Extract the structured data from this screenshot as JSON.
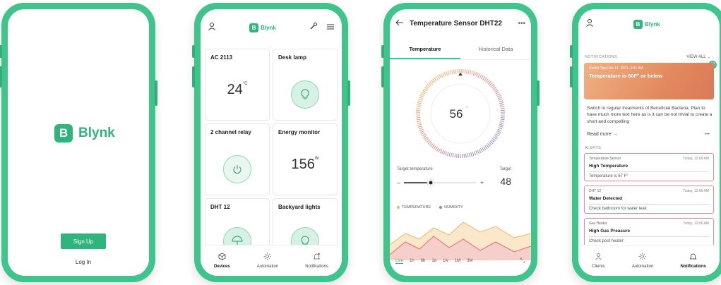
{
  "phone1": {
    "brand": "Blynk",
    "logo_letter": "B",
    "signup": "Sign Up",
    "login": "Log In"
  },
  "phone2": {
    "brand": "Blynk",
    "logo_letter": "B",
    "tiles": [
      {
        "title": "AC 2113",
        "value": "24",
        "unit": "°C"
      },
      {
        "title": "Desk lamp"
      },
      {
        "title": "2 channel relay"
      },
      {
        "title": "Energy monitor",
        "value": "156",
        "unit": "W"
      },
      {
        "title": "DHT 12"
      },
      {
        "title": "Backyard lights"
      }
    ],
    "nav": [
      "Devices",
      "Automation",
      "Notifications"
    ]
  },
  "phone3": {
    "title": "Temperature Sensor DHT22",
    "tabs": [
      "Temperature",
      "Historical Data"
    ],
    "dial_value": "56",
    "dial_unit": "°",
    "target_label": "Target temperature",
    "target_caption": "Target",
    "target_value": "48",
    "legend": [
      "TEMPERATURE",
      "HUMIDITY"
    ],
    "ranges": [
      "Live",
      "1h",
      "6h",
      "1d",
      "1w",
      "1M",
      "3M"
    ],
    "colors": {
      "temperature": "#f2b56b",
      "humidity": "#e96b6b"
    }
  },
  "phone4": {
    "brand": "Blynk",
    "logo_letter": "B",
    "notifications_label": "NOTIFICATIONS",
    "view_all": "VIEW ALL →",
    "badge": "12",
    "hero_tip": "Useful Tips   Feb 14, 2021, 2:01 AM",
    "hero_head": "Temperature is 60F° or below",
    "hero_body": "Switch to regular treatments of Beneficial Bacteria. Plan to have much more text here as is it can be not trivial to create a short and compelling",
    "read_more": "Read more →",
    "alerts_label": "ALERTS",
    "alerts": [
      {
        "source": "Temperature Sensor",
        "time": "Today, 12:06 AM",
        "name": "High Temperature",
        "desc": "Temperature is 67 F°"
      },
      {
        "source": "DHT 12",
        "time": "Today, 12:06 AM",
        "name": "Water Detected",
        "desc": "Check bathroom for water leak"
      },
      {
        "source": "Gas Heater",
        "time": "Today, 12:06 AM",
        "name": "High Gas Preasure",
        "desc": "Check pool heater"
      }
    ],
    "nav": [
      "Clients",
      "Automation",
      "Notifications"
    ]
  }
}
